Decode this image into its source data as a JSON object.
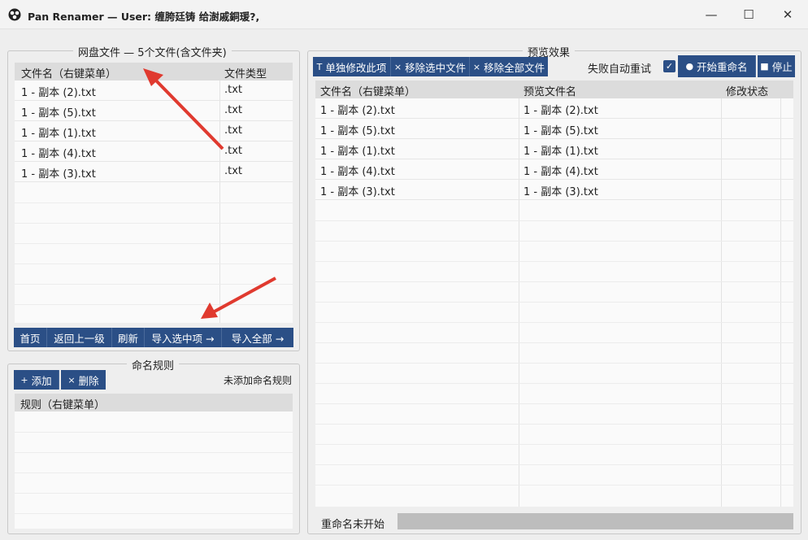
{
  "window": {
    "title": "Pan Renamer — User:  缠胯廷铸    给澍戚銅瑗?,",
    "minimize_glyph": "—",
    "maximize_glyph": "☐",
    "close_glyph": "✕"
  },
  "left_panel": {
    "title": "网盘文件 — 5个文件(含文件夹)",
    "columns": [
      "文件名（右键菜单）",
      "文件类型"
    ],
    "rows": [
      {
        "name": "1 - 副本 (2).txt",
        "type": ".txt"
      },
      {
        "name": "1 - 副本 (5).txt",
        "type": ".txt"
      },
      {
        "name": "1 - 副本 (1).txt",
        "type": ".txt"
      },
      {
        "name": "1 - 副本 (4).txt",
        "type": ".txt"
      },
      {
        "name": "1 - 副本 (3).txt",
        "type": ".txt"
      }
    ],
    "buttons": {
      "home": "首页",
      "up": "返回上一级",
      "refresh": "刷新",
      "import_selected": "导入选中项 →",
      "import_all": "导入全部 →"
    }
  },
  "rules_panel": {
    "title": "命名规则",
    "add_label": "添加",
    "add_glyph": "+",
    "delete_label": "删除",
    "delete_glyph": "×",
    "status": "未添加命名规则",
    "column": "规则（右键菜单）"
  },
  "preview_panel": {
    "title": "预览效果",
    "buttons": {
      "edit_single": "单独修改此项",
      "edit_single_glyph": "T",
      "remove_selected": "移除选中文件",
      "remove_selected_glyph": "×",
      "remove_all": "移除全部文件",
      "remove_all_glyph": "×",
      "start": "开始重命名",
      "start_glyph": "●",
      "stop": "停止",
      "stop_glyph": "■"
    },
    "auto_retry_label": "失败自动重试",
    "auto_retry_checked": true,
    "columns": [
      "文件名（右键菜单）",
      "预览文件名",
      "修改状态"
    ],
    "rows": [
      {
        "name": "1 - 副本 (2).txt",
        "preview": "1 - 副本 (2).txt",
        "status": ""
      },
      {
        "name": "1 - 副本 (5).txt",
        "preview": "1 - 副本 (5).txt",
        "status": ""
      },
      {
        "name": "1 - 副本 (1).txt",
        "preview": "1 - 副本 (1).txt",
        "status": ""
      },
      {
        "name": "1 - 副本 (4).txt",
        "preview": "1 - 副本 (4).txt",
        "status": ""
      },
      {
        "name": "1 - 副本 (3).txt",
        "preview": "1 - 副本 (3).txt",
        "status": ""
      }
    ],
    "progress_label": "重命名未开始",
    "progress_value": 0
  },
  "colors": {
    "accent": "#2b4f86",
    "annotation_arrow": "#e03a2f"
  }
}
